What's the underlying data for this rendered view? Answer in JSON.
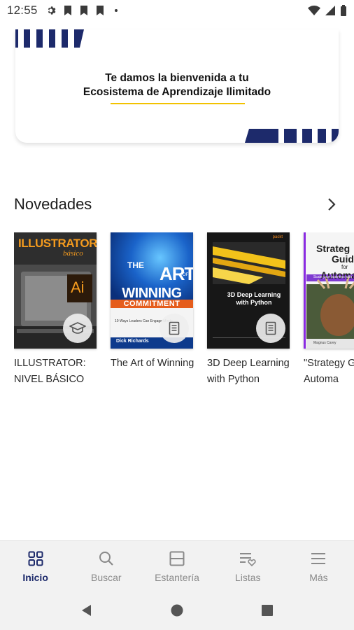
{
  "status_bar": {
    "time": "12:55",
    "icons": [
      "gear-icon",
      "bookmark-icon",
      "bookmark-icon",
      "bookmark-icon",
      "dot-icon"
    ],
    "right_icons": [
      "wifi-icon",
      "signal-icon",
      "battery-icon"
    ]
  },
  "banner": {
    "line1": "Te damos la bienvenida a tu",
    "line2": "Ecosistema de Aprendizaje Ilimitado",
    "accent_color": "#1d2a6b",
    "underline_color": "#f2c200"
  },
  "section": {
    "title": "Novedades"
  },
  "books": [
    {
      "title": "ILLUSTRATOR: NIVEL BÁSICO",
      "badge_icon": "graduation-cap-icon",
      "cover": {
        "heading": "ILLUSTRATOR",
        "subheading": "básico",
        "logo": "Ai"
      }
    },
    {
      "title": "The Art of Winning",
      "badge_icon": "document-icon",
      "cover": {
        "line1": "THE",
        "line2": "ART",
        "line2_sup": "OF",
        "line3": "WINNING",
        "line4": "COMMITMENT",
        "tagline": "10 Ways Leaders Can Engage Minds",
        "author": "Dick Richards"
      }
    },
    {
      "title": "3D Deep Learning with Python",
      "badge_icon": "document-icon",
      "cover": {
        "publisher": "packt",
        "heading": "3D Deep Learning with Python"
      }
    },
    {
      "title": "\"Strategy Guide for Automa",
      "badge_icon": "",
      "cover": {
        "heading1": "Strateg",
        "heading2": "Guide",
        "heading3": "for",
        "heading4": "Automa",
        "subtitle": "Scale your business with",
        "author": "Magnus Carey"
      }
    }
  ],
  "bottom_nav": [
    {
      "label": "Inicio",
      "icon": "grid-icon",
      "active": true
    },
    {
      "label": "Buscar",
      "icon": "search-icon",
      "active": false
    },
    {
      "label": "Estantería",
      "icon": "shelf-icon",
      "active": false
    },
    {
      "label": "Listas",
      "icon": "list-heart-icon",
      "active": false
    },
    {
      "label": "Más",
      "icon": "menu-icon",
      "active": false
    }
  ],
  "system_nav": [
    "back-icon",
    "home-icon",
    "recents-icon"
  ]
}
